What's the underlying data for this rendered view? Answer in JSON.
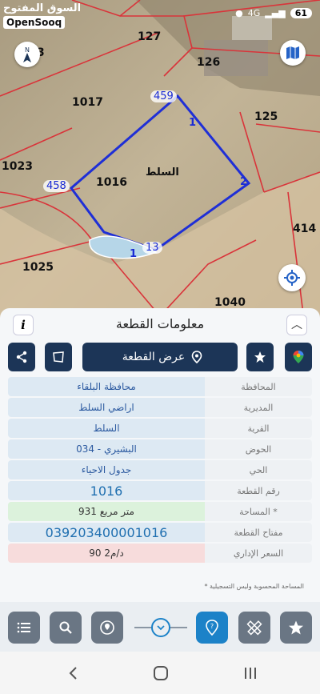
{
  "status": {
    "brand_ar": "السوق المفتوح",
    "brand_en": "OpenSooq",
    "network": "4G",
    "battery": "61"
  },
  "map": {
    "parcels": [
      "127",
      "126",
      "1017",
      "125",
      "1023",
      "1016",
      "414",
      "1025",
      "1040",
      "3"
    ],
    "vertices": [
      "459",
      "458",
      "13"
    ],
    "edges": [
      "1",
      "2",
      "1"
    ],
    "village_label": "السلط"
  },
  "panel": {
    "title": "معلومات القطعة",
    "show_plot_label": "عرض القطعة",
    "rows": [
      {
        "label": "المحافظة",
        "value": "محافظة البلقاء"
      },
      {
        "label": "المديرية",
        "value": "اراضي السلط"
      },
      {
        "label": "القرية",
        "value": "السلط"
      },
      {
        "label": "الحوض",
        "value": "البشيري - 034"
      },
      {
        "label": "الحي",
        "value": "جدول الاحياء"
      },
      {
        "label": "رقم القطعة",
        "value": "1016"
      },
      {
        "label": "المساحة *",
        "value": "931  متر مربع"
      },
      {
        "label": "مفتاح القطعة",
        "value": "039203400001016"
      },
      {
        "label": "السعر الإداري",
        "value": "90 د/م2"
      }
    ],
    "footnote": "* المساحة المحسوبة وليس التسجيلية"
  },
  "colors": {
    "accent": "#1c3557",
    "active_tool": "#1c82c8",
    "plot_outline": "#1f2fd6"
  }
}
